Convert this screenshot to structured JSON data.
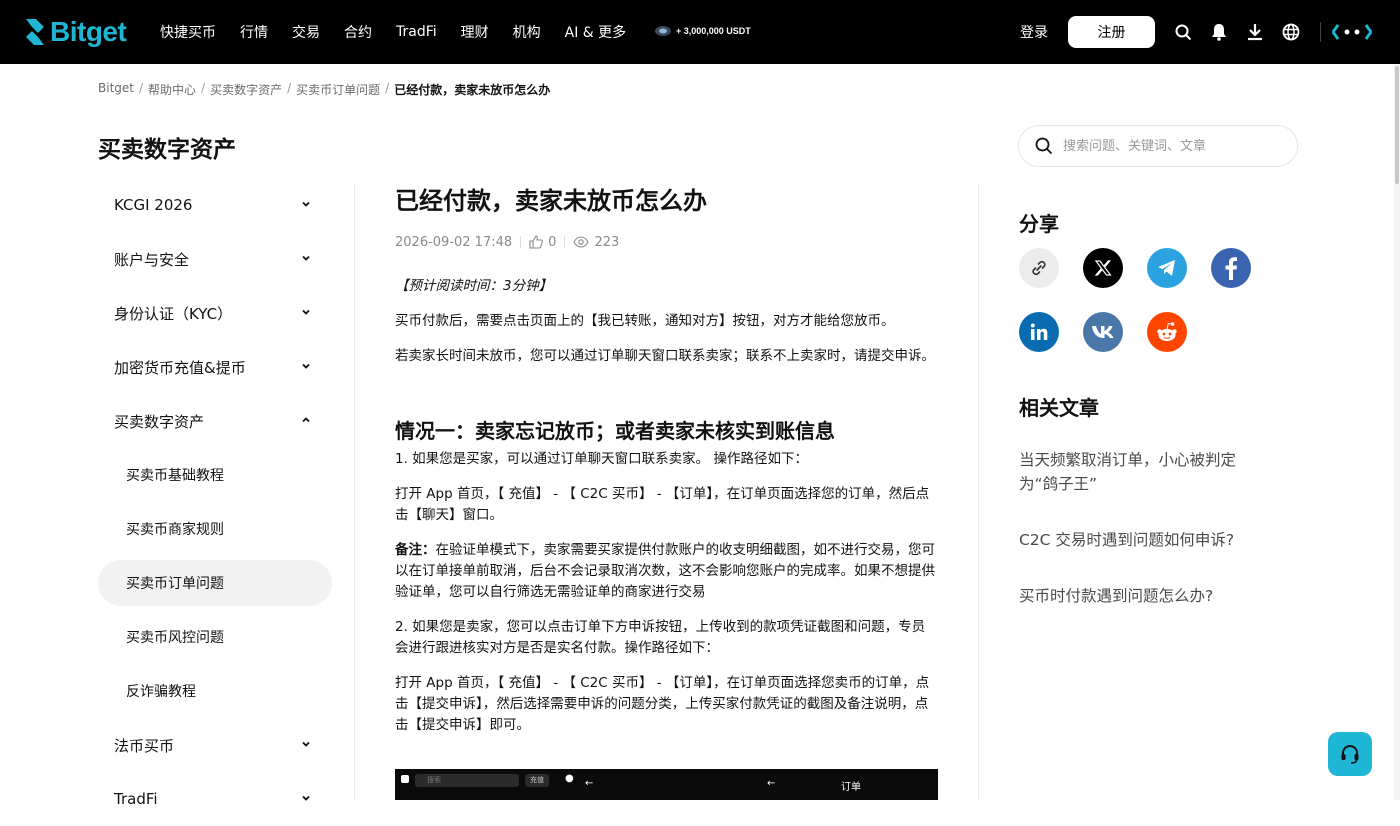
{
  "header": {
    "logo_text": "Bitget",
    "nav": [
      "快捷买币",
      "行情",
      "交易",
      "合约",
      "TradFi",
      "理财",
      "机构",
      "AI & 更多"
    ],
    "promo": "+ 3,000,000 USDT",
    "login": "登录",
    "register": "注册"
  },
  "breadcrumb": [
    "Bitget",
    "帮助中心",
    "买卖数字资产",
    "买卖币订单问题",
    "已经付款，卖家未放币怎么办"
  ],
  "section_title": "买卖数字资产",
  "search": {
    "placeholder": "搜索问题、关键词、文章"
  },
  "sidebar": {
    "items_top": [
      "KCGI 2026",
      "账户与安全",
      "身份认证（KYC）",
      "加密货币充值&提币"
    ],
    "expanded": "买卖数字资产",
    "sub_items": [
      "买卖币基础教程",
      "买卖币商家规则",
      "买卖币订单问题",
      "买卖币风控问题",
      "反诈骗教程"
    ],
    "active_sub": "买卖币订单问题",
    "items_bottom": [
      "法币买币",
      "TradFi"
    ]
  },
  "article": {
    "title": "已经付款，卖家未放币怎么办",
    "date": "2026-09-02 17:48",
    "likes": "0",
    "views": "223",
    "read_time": "【预计阅读时间：3分钟】",
    "p1": "买币付款后，需要点击页面上的【我已转账，通知对方】按钮，对方才能给您放币。",
    "p2": "若卖家长时间未放币，您可以通过订单聊天窗口联系卖家；联系不上卖家时，请提交申诉。",
    "h2": "情况一：卖家忘记放币；或者卖家未核实到账信息",
    "p3": "1. 如果您是买家，可以通过订单聊天窗口联系卖家。 操作路径如下：",
    "p4": "打开 App 首页，【 充值】 - 【 C2C 买币】 - 【订单】，在订单页面选择您的订单，然后点击【聊天】窗口。",
    "note_label": "备注：",
    "note": "在验证单模式下，卖家需要买家提供付款账户的收支明细截图，如不进行交易，您可以在订单接单前取消，后台不会记录取消次数，这不会影响您账户的完成率。如果不想提供验证单，您可以自行筛选无需验证单的商家进行交易",
    "p5": "2. 如果您是卖家，您可以点击订单下方申诉按钮，上传收到的款项凭证截图和问题，专员会进行跟进核实对方是否是实名付款。操作路径如下：",
    "p6": "打开 App 首页，【 充值】 - 【 C2C 买币】 - 【订单】，在订单页面选择您卖币的订单，点击【提交申诉】，然后选择需要申诉的问题分类，上传买家付款凭证的截图及备注说明，点击【提交申诉】即可。",
    "preview": {
      "search": "搜索",
      "button": "充值",
      "order_title": "订单"
    }
  },
  "share": {
    "title": "分享",
    "icons": [
      "link-icon",
      "x-icon",
      "telegram-icon",
      "facebook-icon",
      "linkedin-icon",
      "vk-icon",
      "reddit-icon"
    ]
  },
  "related": {
    "title": "相关文章",
    "links": [
      "当天频繁取消订单，小心被判定为“鸽子王”",
      "C2C 交易时遇到问题如何申诉?",
      "买币时付款遇到问题怎么办?"
    ]
  },
  "colors": {
    "brand": "#1fb6d5",
    "telegram": "#2aa3e0",
    "facebook": "#3b64b0",
    "linkedin": "#0a6cb0",
    "vk": "#4a76a8",
    "reddit": "#ff4500"
  }
}
